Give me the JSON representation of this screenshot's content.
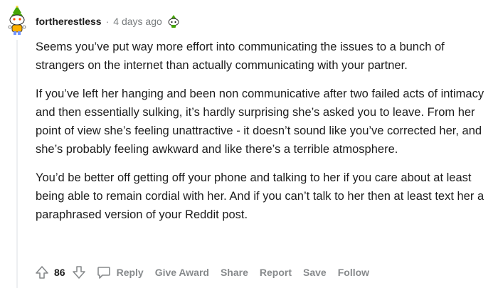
{
  "comment": {
    "username": "fortherestless",
    "separator": "·",
    "timestamp": "4 days ago",
    "paragraphs": [
      "Seems you’ve put way more effort into communicating the issues to a bunch of strangers on the internet than actually communicating with your partner.",
      "If you’ve left her hanging and been non communicative after two failed acts of intimacy and then essentially sulking, it’s hardly surprising she’s asked you to leave. From her point of view she’s feeling unattractive - it doesn’t sound like you’ve corrected her, and she’s probably feeling awkward and like there’s a terrible atmosphere.",
      "You’d be better off getting off your phone and talking to her if you care about at least being able to remain cordial with her. And if you can’t talk to her then at least text her a paraphrased version of your Reddit post."
    ],
    "score": "86"
  },
  "actions": {
    "reply": "Reply",
    "give_award": "Give Award",
    "share": "Share",
    "report": "Report",
    "save": "Save",
    "follow": "Follow"
  },
  "icons": {
    "avatar": "snoo-avatar-icon",
    "award": "snoo-award-icon",
    "upvote": "upvote-arrow-icon",
    "downvote": "downvote-arrow-icon",
    "reply": "speech-bubble-icon"
  },
  "colors": {
    "text": "#1c1c1c",
    "muted": "#878a8c",
    "thread_line": "#edeff1"
  }
}
